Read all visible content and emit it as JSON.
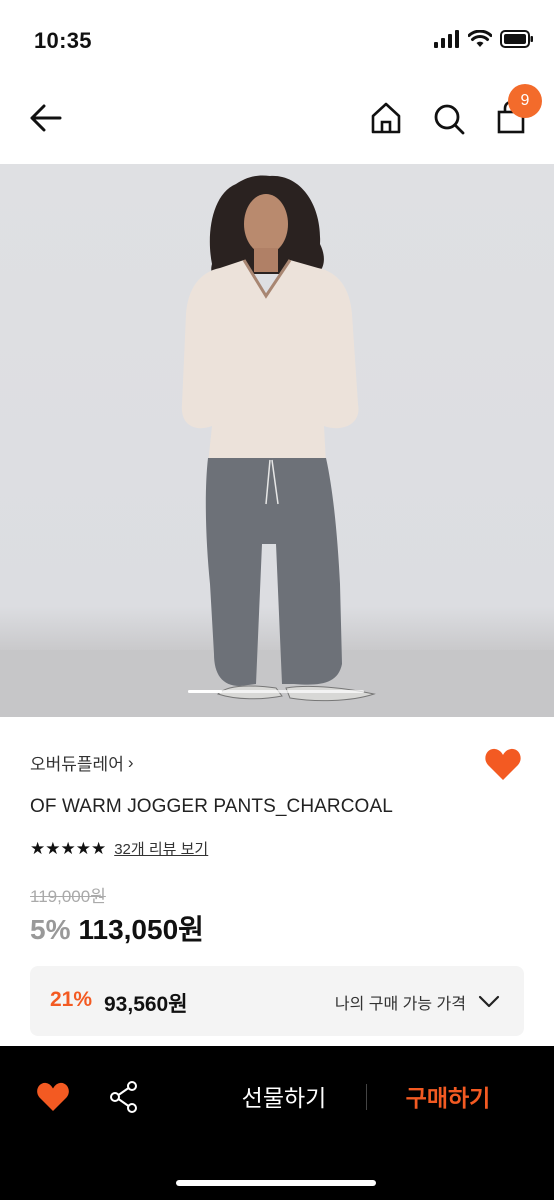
{
  "status": {
    "time": "10:35"
  },
  "header": {
    "cart_count": "9"
  },
  "product": {
    "brand": "오버듀플레어",
    "brand_chevron": "›",
    "title": "OF WARM JOGGER PANTS_CHARCOAL",
    "stars": "★★★★★",
    "review_link": "32개 리뷰 보기",
    "original_price": "119,000원",
    "discount_rate": "5%",
    "sale_price": "113,050원"
  },
  "my_price": {
    "rate": "21%",
    "price": "93,560원",
    "label": "나의 구매 가능 가격"
  },
  "bottom_bar": {
    "gift_label": "선물하기",
    "buy_label": "구매하기"
  },
  "colors": {
    "accent": "#f35a22",
    "badge": "#f36b2b"
  },
  "icons": [
    "back-arrow-icon",
    "home-icon",
    "search-icon",
    "cart-icon",
    "heart-icon",
    "share-icon",
    "chevron-down-icon"
  ]
}
